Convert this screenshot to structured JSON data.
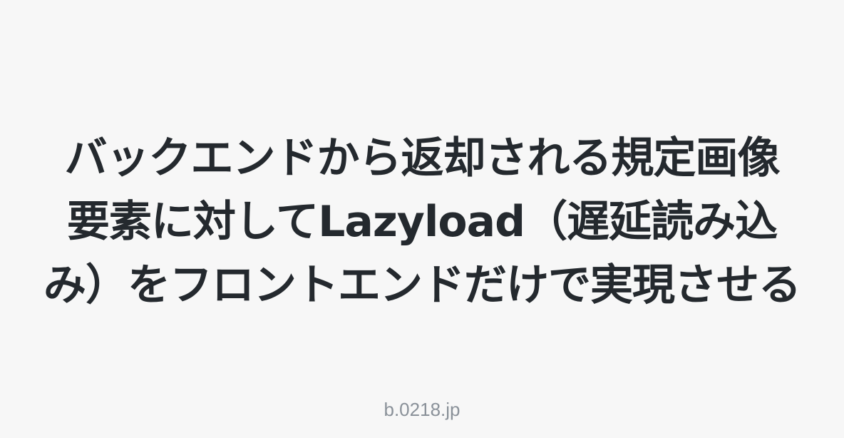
{
  "title_lines": [
    "バックエンドから返却される規定画像",
    "要素に対してLazyload（遅延読み込",
    "み）をフロントエンドだけで実現させる"
  ],
  "site_domain": "b.0218.jp",
  "colors": {
    "background": "#f7f7f7",
    "title_text": "#24292e",
    "domain_text": "#8a9199"
  }
}
